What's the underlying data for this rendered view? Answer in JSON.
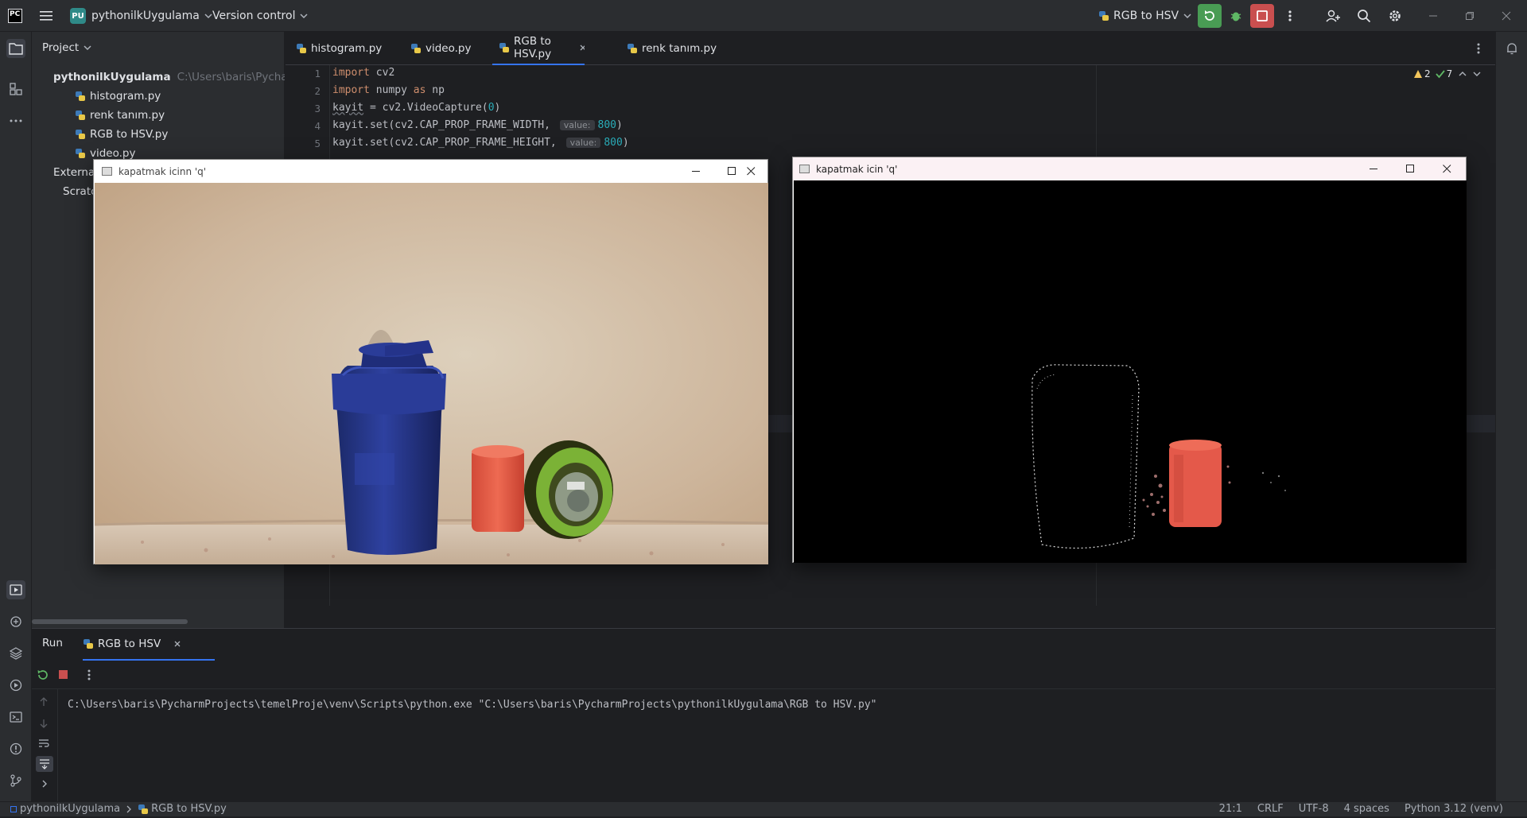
{
  "titlebar": {
    "app_logo": "PC",
    "project_badge": "PU",
    "project_name": "pythonilkUygulama",
    "vcs_label": "Version control",
    "run_config": "RGB to HSV"
  },
  "project_panel": {
    "title": "Project",
    "root_name": "pythonilkUygulama",
    "root_path": "C:\\Users\\baris\\PycharmProjects\\pythonilkUygulama",
    "files": [
      "histogram.py",
      "renk tanım.py",
      "RGB to HSV.py",
      "video.py"
    ],
    "external_libraries": "External Libraries",
    "scratches": "Scratches and Consoles"
  },
  "editor": {
    "tabs": [
      "histogram.py",
      "video.py",
      "RGB to HSV.py",
      "renk tanım.py"
    ],
    "active_tab": 2,
    "warnings": "2",
    "checks": "7",
    "line_numbers": [
      "1",
      "2",
      "3",
      "4",
      "5"
    ],
    "lines": {
      "l1_kw": "import",
      "l1_rest": " cv2",
      "l2_kw": "import",
      "l2_mid": " numpy ",
      "l2_as": "as",
      "l2_rest": " np",
      "l3_var": "kayit",
      "l3_mid": " = cv2.VideoCapture(",
      "l3_num": "0",
      "l3_end": ")",
      "l4_code": "kayit.set(cv2.CAP_PROP_FRAME_WIDTH, ",
      "l4_hint": "value:",
      "l4_num": "800",
      "l4_end": ")",
      "l5_code": "kayit.set(cv2.CAP_PROP_FRAME_HEIGHT, ",
      "l5_hint": "value:",
      "l5_num": "800",
      "l5_end": ")"
    }
  },
  "windows": {
    "left_title": "kapatmak icinn 'q'",
    "right_title": "kapatmak icin 'q'"
  },
  "run_panel": {
    "tab_run": "Run",
    "tab_config": "RGB to HSV",
    "output": "C:\\Users\\baris\\PycharmProjects\\temelProje\\venv\\Scripts\\python.exe \"C:\\Users\\baris\\PycharmProjects\\pythonilkUygulama\\RGB to HSV.py\""
  },
  "statusbar": {
    "crumb_project": "pythonilkUygulama",
    "crumb_file": "RGB to HSV.py",
    "position": "21:1",
    "line_sep": "CRLF",
    "encoding": "UTF-8",
    "indent": "4 spaces",
    "interpreter": "Python 3.12 (venv)"
  },
  "colors": {
    "ide_bg": "#1e1f22",
    "panel_bg": "#2b2d30",
    "accent": "#3574f0",
    "run_green": "#499c54",
    "stop_red": "#c94f4f"
  }
}
